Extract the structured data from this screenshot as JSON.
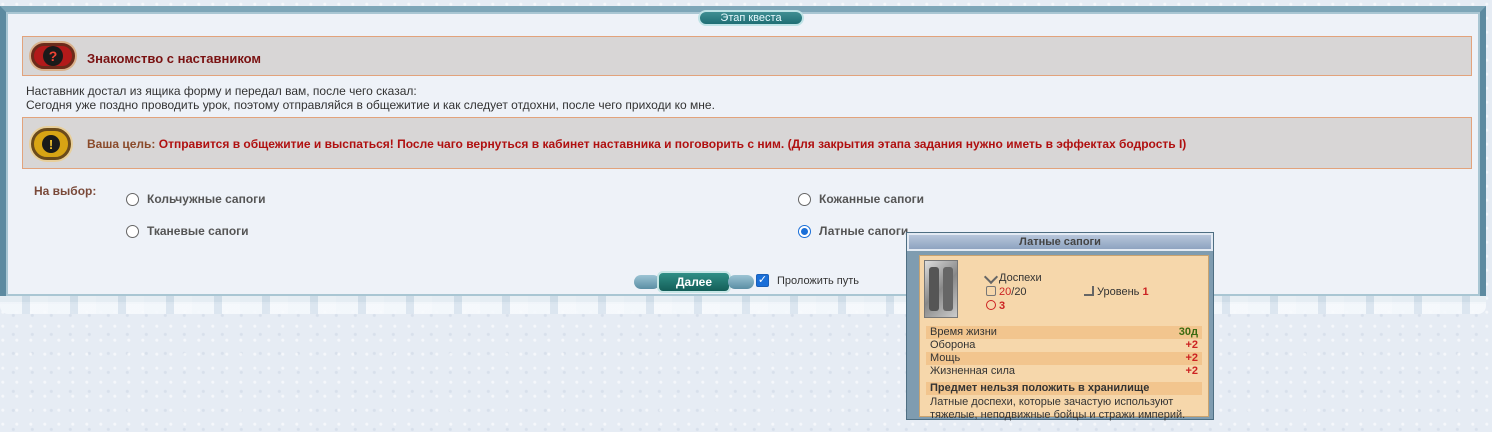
{
  "stage_tab": "Этап квеста",
  "header": {
    "title": "Знакомство с наставником",
    "icon": "question-icon"
  },
  "description": {
    "line1": "Наставник достал из ящика форму и передал вам, после чего сказал:",
    "line2": "Сегодня уже поздно проводить урок, поэтому отправляйся в общежитие и как следует отдохни, после чего приходи ко мне."
  },
  "goal": {
    "label": "Ваша цель:",
    "text": "Отправится в общежитие и выспаться! После чаго вернуться в кабинет наставника и поговорить с ним. (Для закрытия этапа задания нужно иметь в эффектах бодрость I)",
    "icon": "exclamation-icon"
  },
  "choice": {
    "label": "На выбор:",
    "options": [
      {
        "label": "Кольчужные сапоги",
        "checked": false
      },
      {
        "label": "Кожанные сапоги",
        "checked": false
      },
      {
        "label": "Тканевые сапоги",
        "checked": false
      },
      {
        "label": "Латные сапоги",
        "checked": true
      }
    ]
  },
  "actions": {
    "next_label": "Далее",
    "path_label": "Проложить путь",
    "path_checked": true
  },
  "tooltip": {
    "title": "Латные сапоги",
    "type": "Доспехи",
    "durability_current": "20",
    "durability_sep": "/",
    "durability_max": "20",
    "requirement": "3",
    "level_label": "Уровень",
    "level_value": "1",
    "stats": [
      {
        "name": "Время жизни",
        "value": "30д"
      },
      {
        "name": "Оборона",
        "value": "+2"
      },
      {
        "name": "Мощь",
        "value": "+2"
      },
      {
        "name": "Жизненная сила",
        "value": "+2"
      }
    ],
    "note": "Предмет нельзя положить в хранилище",
    "desc_line1": "Латные доспехи, которые зачастую используют",
    "desc_line2": "тяжелые, неподвижные бойцы и стражи империй."
  }
}
